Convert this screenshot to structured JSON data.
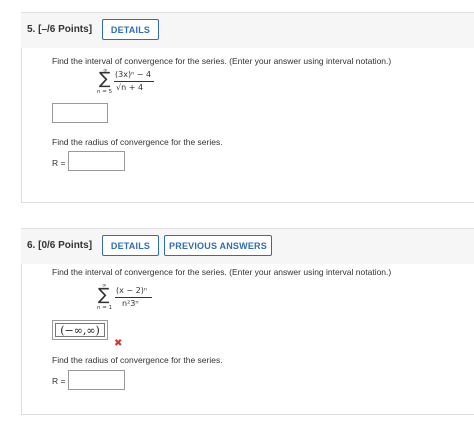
{
  "q5": {
    "number": "5.",
    "points": "[–/6 Points]",
    "details_label": "DETAILS",
    "prompt1": "Find the interval of convergence for the series. (Enter your answer using interval notation.)",
    "sum_upper": "∞",
    "sum_lower": "n = 5",
    "numerator": "(3x)ⁿ − 4",
    "denominator": "√n + 4",
    "interval_answer": "",
    "prompt2": "Find the radius of convergence for the series.",
    "r_label": "R =",
    "r_answer": ""
  },
  "q6": {
    "number": "6.",
    "points": "[0/6 Points]",
    "details_label": "DETAILS",
    "previous_answers_label": "PREVIOUS ANSWERS",
    "prompt1": "Find the interval of convergence for the series. (Enter your answer using interval notation.)",
    "sum_upper": "∞",
    "sum_lower": "n = 1",
    "numerator": "(x − 2)ⁿ",
    "denominator": "n²3ⁿ",
    "interval_answer": "(−∞,∞)",
    "incorrect_mark": "✖",
    "prompt2": "Find the radius of convergence for the series.",
    "r_label": "R =",
    "r_answer": ""
  },
  "colors": {
    "accent": "#2f6db5",
    "incorrect": "#d9332b",
    "header_bg": "#f6f6f6"
  }
}
